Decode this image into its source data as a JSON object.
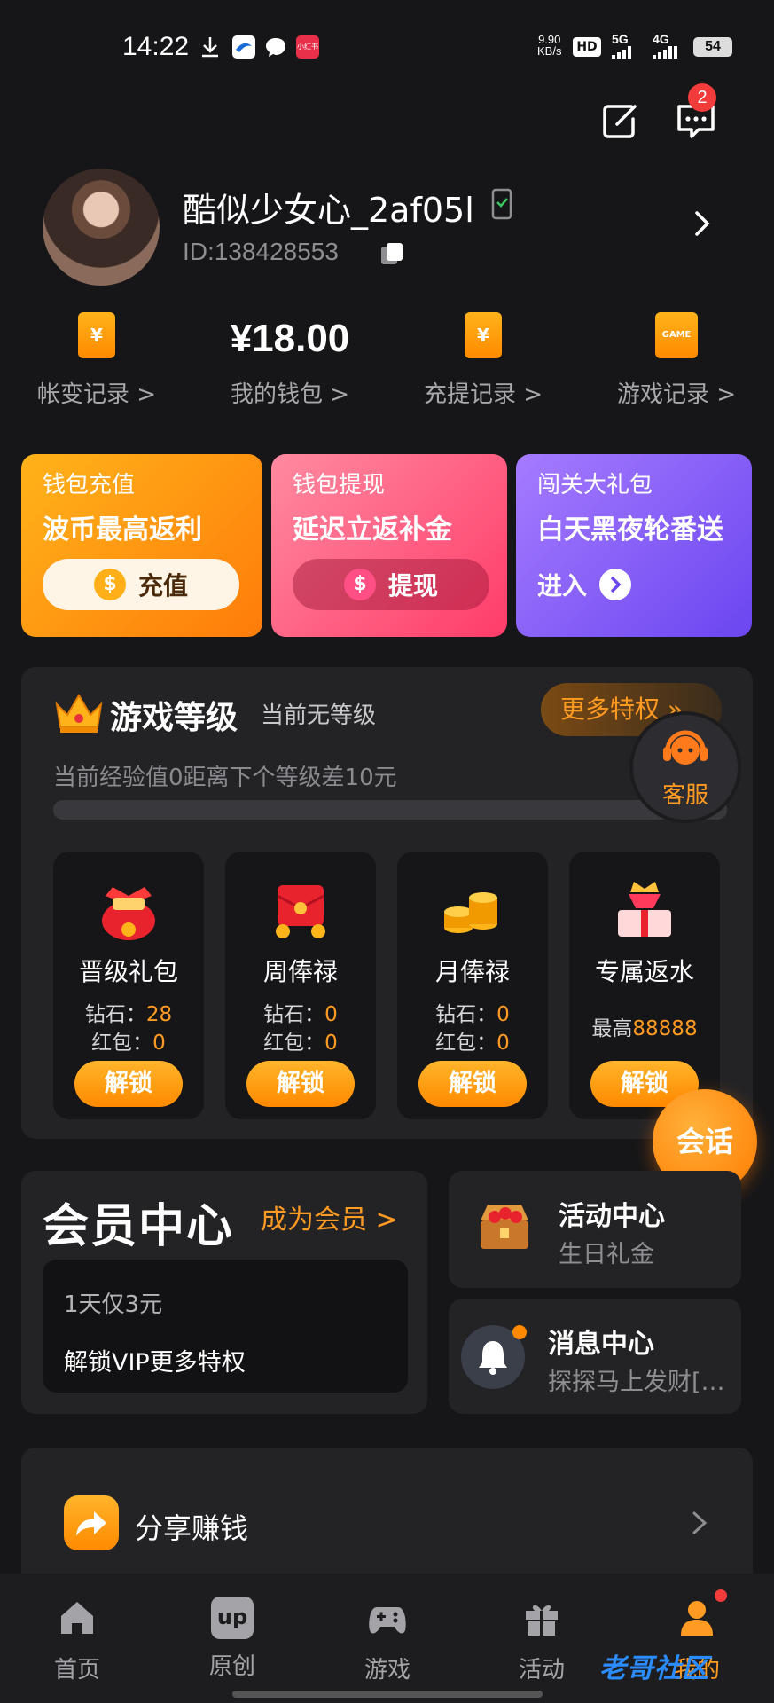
{
  "status_bar": {
    "time": "14:22",
    "net_speed": "9.90\nKB/s",
    "net_speed_top": "9.90",
    "net_speed_bottom": "KB/s",
    "hd": "HD",
    "signal_1": "5G",
    "signal_2": "4G",
    "battery": "54",
    "app_icon_label": "小红书"
  },
  "profile": {
    "username": "酷似少女心_2af05l",
    "user_id": "ID:138428553"
  },
  "header": {
    "message_badge": "2"
  },
  "wallet": {
    "balance": "¥18.00",
    "items": [
      {
        "label": "帐变记录 >",
        "icon_text": "¥"
      },
      {
        "label": "我的钱包 >"
      },
      {
        "label": "充提记录 >",
        "icon_text": "¥"
      },
      {
        "label": "游戏记录 >",
        "icon_text": "GAME"
      }
    ]
  },
  "promos": [
    {
      "title": "钱包充值",
      "subtitle": "波币最高返利",
      "button": "充值",
      "coin": "$"
    },
    {
      "title": "钱包提现",
      "subtitle": "延迟立返补金",
      "button": "提现",
      "coin": "$"
    },
    {
      "title": "闯关大礼包",
      "subtitle": "白天黑夜轮番送",
      "button": "进入"
    }
  ],
  "level": {
    "title": "游戏等级",
    "current": "当前无等级",
    "more": "更多特权 »",
    "note": "当前经验值0距离下个等级差10元",
    "progress": 0,
    "service_label": "客服",
    "perks": [
      {
        "name": "晋级礼包",
        "row1_label": "钻石：",
        "row1_value": "28",
        "row2_label": "红包：",
        "row2_value": "0",
        "button": "解锁",
        "gift_text": "晋级礼包"
      },
      {
        "name": "周俸禄",
        "row1_label": "钻石：",
        "row1_value": "0",
        "row2_label": "红包：",
        "row2_value": "0",
        "button": "解锁"
      },
      {
        "name": "月俸禄",
        "row1_label": "钻石：",
        "row1_value": "0",
        "row2_label": "红包：",
        "row2_value": "0",
        "button": "解锁"
      },
      {
        "name": "专属返水",
        "max_label": "最高",
        "max_value": "88888",
        "button": "解锁"
      }
    ]
  },
  "chat_button": "会话",
  "vip": {
    "title": "会员中心",
    "link": "成为会员 >",
    "line1": "1天仅3元",
    "line2": "解锁VIP更多特权"
  },
  "activity": {
    "title": "活动中心",
    "subtitle": "生日礼金"
  },
  "messages": {
    "title": "消息中心",
    "subtitle": "探探马上发财[…"
  },
  "share": {
    "label": "分享赚钱"
  },
  "tabs": [
    {
      "label": "首页"
    },
    {
      "label": "原创",
      "icon_text": "up"
    },
    {
      "label": "游戏"
    },
    {
      "label": "活动"
    },
    {
      "label": "我的"
    }
  ],
  "watermark": "老哥社区",
  "colors": {
    "accent": "#ff9a22",
    "background": "#161618",
    "card": "#232326",
    "badge": "#f23b3b"
  }
}
